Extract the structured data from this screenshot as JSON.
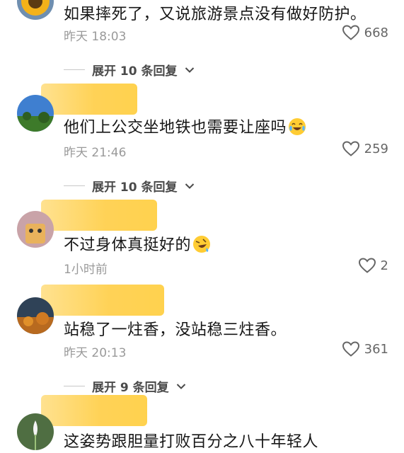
{
  "comments": [
    {
      "text": "如果摔死了，又说旅游景点没有做好防护。",
      "time": "昨天 18:03",
      "likes": "668",
      "replies_label": "展开 10 条回复",
      "avatar_icon": "sunflower-avatar-icon"
    },
    {
      "text": "他们上公交坐地铁也需要让座吗",
      "emoji": "tears-of-joy-emoji",
      "time": "昨天 21:46",
      "likes": "259",
      "replies_label": "展开 10 条回复",
      "avatar_icon": "landscape-avatar-icon"
    },
    {
      "text": "不过身体真挺好的",
      "emoji": "rolling-laughing-emoji",
      "time": "1小时前",
      "likes": "2",
      "avatar_icon": "cartoon-avatar-icon"
    },
    {
      "text": "站稳了一炷香，没站稳三炷香。",
      "time": "昨天 20:13",
      "likes": "361",
      "replies_label": "展开 9 条回复",
      "avatar_icon": "autumn-avatar-icon"
    },
    {
      "text": "这姿势跟胆量打败百分之八十年轻人",
      "avatar_icon": "snowdrop-avatar-icon"
    }
  ],
  "colors": {
    "name_mask": "#ffd04e",
    "time_text": "#9a9a9a",
    "body_text": "#161616"
  }
}
